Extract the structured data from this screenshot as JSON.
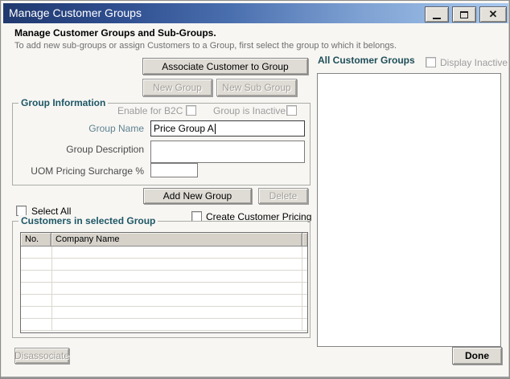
{
  "window": {
    "title": "Manage Customer Groups",
    "close_glyph": "✕"
  },
  "header": {
    "subtitle": "Manage Customer Groups and Sub-Groups.",
    "description": "To add new sub-groups or assign Customers to a Group, first select the group to which it belongs."
  },
  "buttons": {
    "associate": "Associate Customer to Group",
    "new_group": "New Group",
    "new_sub_group": "New Sub Group",
    "add_new_group": "Add New Group",
    "delete": "Delete",
    "disassociate": "Disassociate",
    "done": "Done"
  },
  "group_information": {
    "title": "Group Information",
    "enable_b2c_label": "Enable for B2C",
    "enable_b2c_checked": false,
    "group_inactive_label": "Group is Inactive",
    "group_inactive_checked": false,
    "group_name_label": "Group Name",
    "group_name_value": "Price Group A",
    "group_description_label": "Group Description",
    "group_description_value": "",
    "uom_surcharge_label": "UOM Pricing Surcharge %",
    "uom_surcharge_value": ""
  },
  "checkboxes": {
    "select_all_label": "Select All",
    "select_all_checked": false,
    "create_customer_pricing_label": "Create Customer Pricing",
    "create_customer_pricing_checked": false,
    "display_inactive_label": "Display Inactive",
    "display_inactive_checked": false
  },
  "customers_table": {
    "title": "Customers in selected Group",
    "columns": [
      "No.",
      "Company Name"
    ],
    "rows": []
  },
  "all_customer_groups": {
    "title": "All Customer Groups",
    "items": []
  },
  "colors": {
    "titlebar_gradient_start": "#20396F",
    "titlebar_gradient_end": "#A9C9EE",
    "groupbox_title_teal": "#1E5766",
    "section_title_teal": "#1E4E58",
    "button_face": "#DFDCD5",
    "disabled_text": "#A3A09A"
  }
}
